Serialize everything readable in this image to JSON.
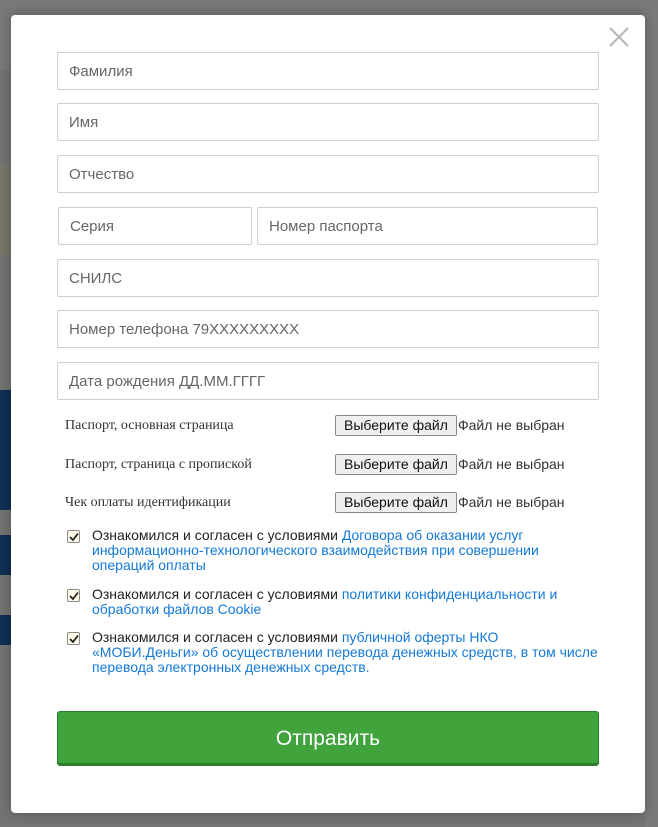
{
  "form": {
    "lastname_placeholder": "Фамилия",
    "firstname_placeholder": "Имя",
    "middlename_placeholder": "Отчество",
    "series_placeholder": "Серия",
    "passport_number_placeholder": "Номер паспорта",
    "snils_placeholder": "СНИЛС",
    "phone_placeholder": "Номер телефона 79XXXXXXXXX",
    "birthdate_placeholder": "Дата рождения ДД.ММ.ГГГГ"
  },
  "files": [
    {
      "label": "Паспорт, основная страница",
      "button": "Выберите файл",
      "status": "Файл не выбран"
    },
    {
      "label": "Паспорт, страница с пропиской",
      "button": "Выберите файл",
      "status": "Файл не выбран"
    },
    {
      "label": "Чек оплаты идентификации",
      "button": "Выберите файл",
      "status": "Файл не выбран"
    }
  ],
  "agreements": [
    {
      "prefix": "Ознакомился и согласен с условиями ",
      "link": "Договора об оказании услуг информационно-технологического взаимодействия при совершении операций оплаты",
      "checked": true
    },
    {
      "prefix": "Ознакомился и согласен с условиями ",
      "link": "политики конфиденциальности и обработки файлов Cookie",
      "checked": true
    },
    {
      "prefix": "Ознакомился и согласен с условиями ",
      "link": "публичной оферты НКО «МОБИ.Деньги» об осуществлении перевода денежных средств, в том числе перевода электронных денежных средств.",
      "checked": true
    }
  ],
  "submit_label": "Отправить",
  "colors": {
    "accent_green": "#40a33c",
    "link_blue": "#1479d6",
    "background_blue": "#1f5ea8"
  },
  "icons": {
    "close": "close-icon",
    "check": "checkmark-icon"
  }
}
